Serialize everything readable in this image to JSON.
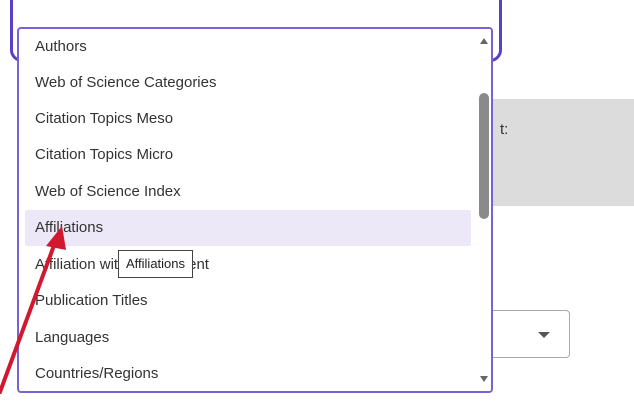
{
  "background": {
    "panel_text": "t:"
  },
  "dropdown": {
    "options": [
      {
        "label": "Authors"
      },
      {
        "label": "Web of Science Categories"
      },
      {
        "label": "Citation Topics Meso"
      },
      {
        "label": "Citation Topics Micro"
      },
      {
        "label": "Web of Science Index"
      },
      {
        "label": "Affiliations"
      },
      {
        "label": "Affiliation with Department"
      },
      {
        "label": "Publication Titles"
      },
      {
        "label": "Languages"
      },
      {
        "label": "Countries/Regions"
      }
    ],
    "hovered_option": "Affiliations"
  },
  "tooltip": {
    "text": "Affiliations"
  },
  "colors": {
    "accent": "#5b3fc4",
    "dropdown_border": "#7b61d6",
    "hover_bg": "#ece8f7",
    "annotation_arrow": "#d0192f"
  },
  "icons": {
    "scroll_up": "triangle-up-icon",
    "scroll_down": "triangle-down-icon",
    "select_caret": "caret-down-icon",
    "annotation": "red-arrow-icon"
  }
}
